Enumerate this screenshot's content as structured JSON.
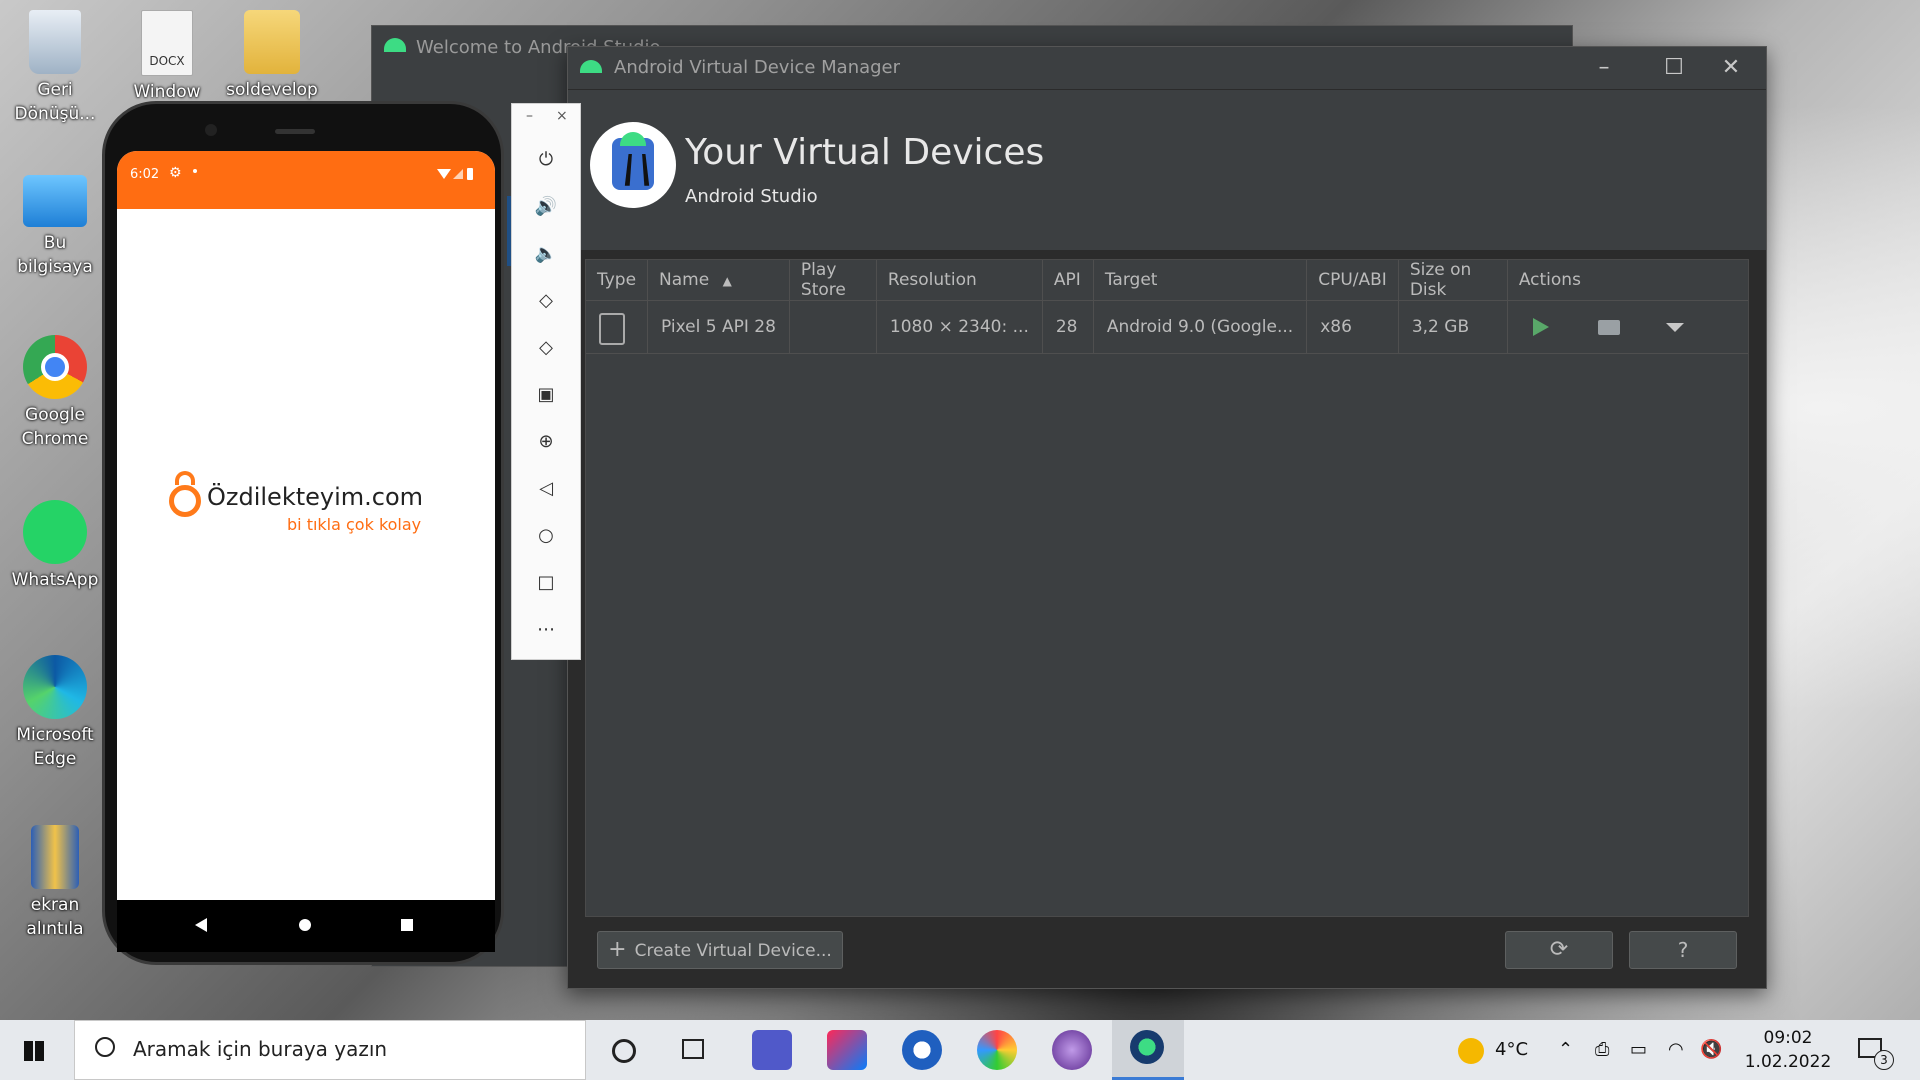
{
  "desktop": {
    "icons": [
      {
        "label": "Geri Dönüşü..."
      },
      {
        "label": "Window"
      },
      {
        "label": "soldevelop"
      },
      {
        "label": "Bu bilgisaya"
      },
      {
        "label": "Google Chrome"
      },
      {
        "label": "WhatsApp"
      },
      {
        "label": "Microsoft Edge"
      },
      {
        "label": "ekran alıntıla"
      }
    ],
    "docx_badge": "DOCX"
  },
  "welcome_window": {
    "title": "Welcome to Android Studio"
  },
  "avd_manager": {
    "window_title": "Android Virtual Device Manager",
    "heading": "Your Virtual Devices",
    "subheading": "Android Studio",
    "columns": [
      "Type",
      "Name",
      "Play Store",
      "Resolution",
      "API",
      "Target",
      "CPU/ABI",
      "Size on Disk",
      "Actions"
    ],
    "sort_indicator": "▲",
    "rows": [
      {
        "name": "Pixel 5 API 28",
        "play_store": "",
        "resolution": "1080 × 2340: ...",
        "api": "28",
        "target": "Android 9.0 (Google...",
        "cpu": "x86",
        "size": "3,2 GB"
      }
    ],
    "create_button": "Create Virtual Device...",
    "help_button": "?",
    "colors": {
      "play_green": "#59a869",
      "accent": "#3c3f41"
    }
  },
  "emulator": {
    "status_time": "6:02",
    "app_brand": "Özdilekteyim.com",
    "app_tagline": "bi tıkla çok kolay",
    "brand_color": "#ff6d12",
    "side_controls": [
      "power-icon",
      "volume-up-icon",
      "volume-down-icon",
      "rotate-left-icon",
      "rotate-right-icon",
      "camera-icon",
      "zoom-icon",
      "back-icon",
      "home-icon",
      "overview-icon",
      "more-icon"
    ]
  },
  "taskbar": {
    "search_placeholder": "Aramak için buraya yazın",
    "weather": "4°C",
    "time": "09:02",
    "date": "1.02.2022",
    "notifications": "3"
  }
}
